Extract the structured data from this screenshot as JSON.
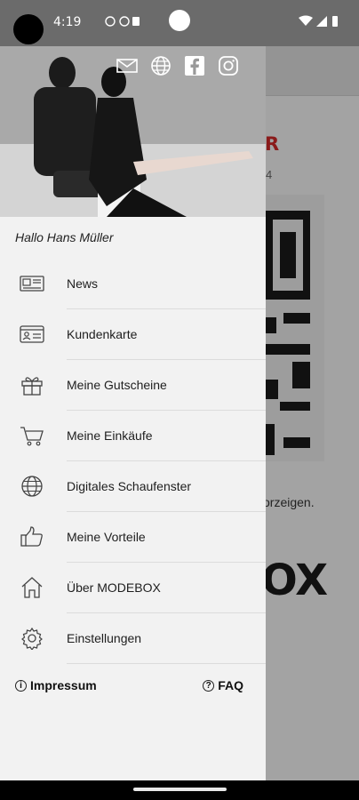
{
  "status_bar": {
    "time": "4:19"
  },
  "background": {
    "title": "R",
    "subtitle": "4",
    "hint": "orzeigen.",
    "logo": "OX"
  },
  "drawer": {
    "greeting": "Hallo Hans Müller",
    "social_icons": [
      "mail-icon",
      "globe-icon",
      "facebook-icon",
      "instagram-icon"
    ],
    "menu": [
      {
        "label": "News",
        "icon": "news-icon"
      },
      {
        "label": "Kundenkarte",
        "icon": "id-card-icon"
      },
      {
        "label": "Meine Gutscheine",
        "icon": "gift-icon"
      },
      {
        "label": "Meine Einkäufe",
        "icon": "cart-icon"
      },
      {
        "label": "Digitales Schaufenster",
        "icon": "globe-icon"
      },
      {
        "label": "Meine Vorteile",
        "icon": "thumbs-up-icon"
      },
      {
        "label": "Über MODEBOX",
        "icon": "home-icon"
      },
      {
        "label": "Einstellungen",
        "icon": "gear-icon"
      }
    ],
    "footer": {
      "impressum": "Impressum",
      "faq": "FAQ"
    }
  },
  "colors": {
    "drawer_bg": "#f2f2f2",
    "accent": "#8a1a1a"
  }
}
